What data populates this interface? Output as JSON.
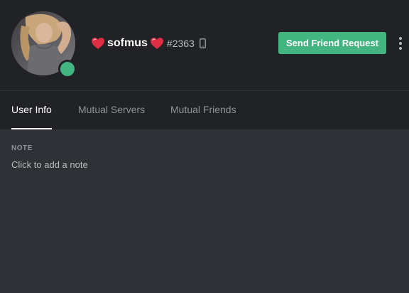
{
  "profile": {
    "username": "sofmus",
    "discriminator": "#2363",
    "status": "online",
    "status_color": "#43b581",
    "name_decoration_icon": "heart-icon",
    "platform_icon": "mobile-phone-icon",
    "actions": {
      "send_friend_request_label": "Send Friend Request",
      "more_icon": "more-vertical-icon"
    }
  },
  "tabs": [
    {
      "label": "User Info",
      "active": true
    },
    {
      "label": "Mutual Servers",
      "active": false
    },
    {
      "label": "Mutual Friends",
      "active": false
    }
  ],
  "note": {
    "label": "NOTE",
    "placeholder": "Click to add a note"
  },
  "colors": {
    "header_bg": "#202225",
    "body_bg": "#2f3136",
    "accent_green": "#43b581",
    "heart_red": "#dd2e44"
  }
}
